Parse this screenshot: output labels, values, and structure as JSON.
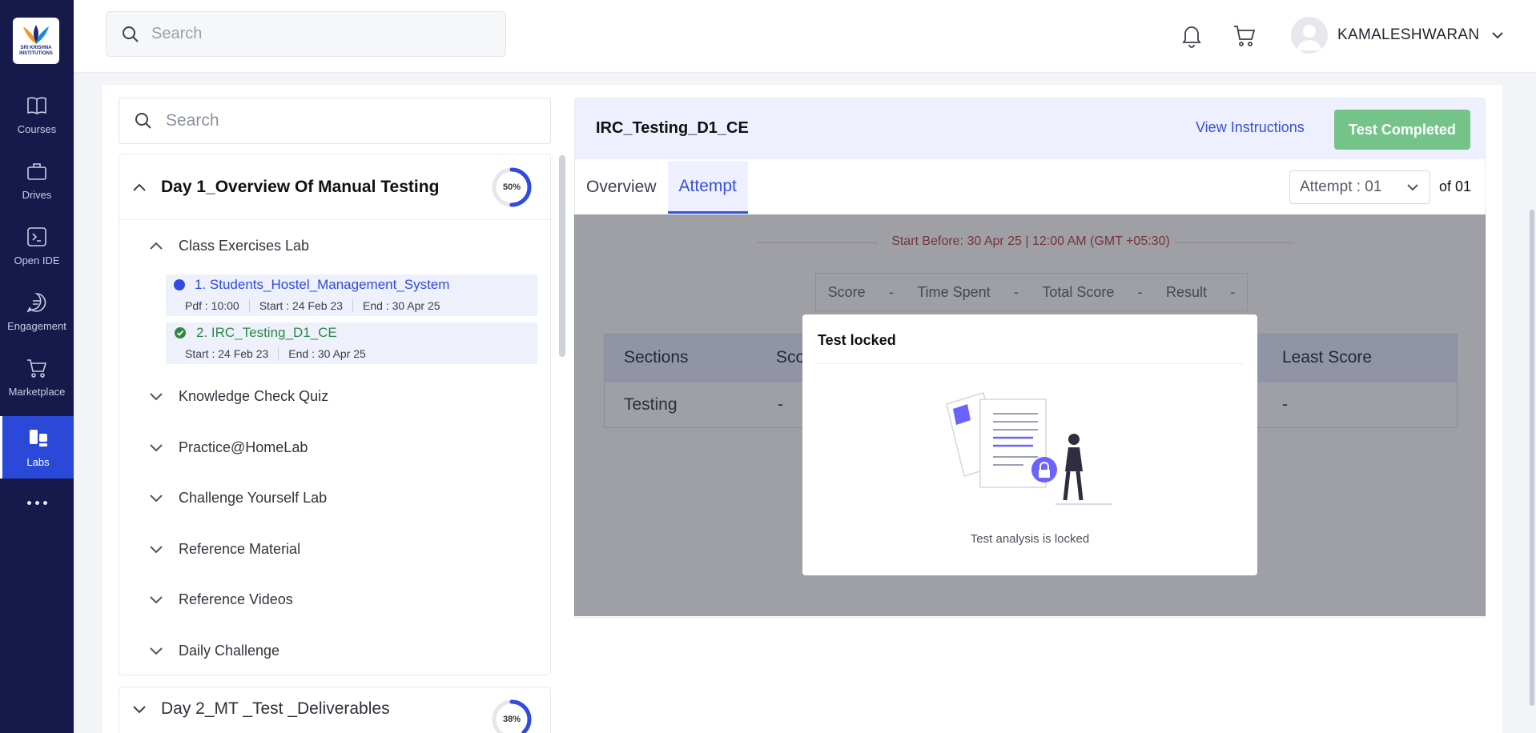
{
  "sidebar": {
    "logo_text": "SRI KRISHNA INSTITUTIONS",
    "items": [
      {
        "label": "Courses",
        "icon": "book-icon"
      },
      {
        "label": "Drives",
        "icon": "briefcase-icon"
      },
      {
        "label": "Open IDE",
        "icon": "terminal-icon"
      },
      {
        "label": "Engagement",
        "icon": "chat-icon"
      },
      {
        "label": "Marketplace",
        "icon": "cart-icon"
      },
      {
        "label": "Labs",
        "icon": "labs-icon",
        "active": true
      }
    ]
  },
  "topbar": {
    "search_placeholder": "Search",
    "user_name": "KAMALESHWARAN"
  },
  "left": {
    "search_placeholder": "Search",
    "day1": {
      "title": "Day 1_Overview Of Manual Testing",
      "progress": "50%",
      "progress_value": 0.5,
      "sections": {
        "class_exercises": "Class Exercises Lab",
        "knowledge_check": "Knowledge Check Quiz",
        "practice": "Practice@HomeLab",
        "challenge": "Challenge Yourself Lab",
        "reference_material": "Reference Material",
        "reference_videos": "Reference Videos",
        "daily_challenge": "Daily Challenge"
      },
      "items": [
        {
          "title": "1. Students_Hostel_Management_System",
          "pdf": "Pdf : 10:00",
          "start": "Start : 24 Feb 23",
          "end": "End : 30 Apr 25"
        },
        {
          "title": "2. IRC_Testing_D1_CE",
          "start": "Start : 24 Feb 23",
          "end": "End : 30 Apr 25"
        }
      ]
    },
    "day2": {
      "title": "Day 2_MT _Test _Deliverables",
      "progress": "38%",
      "progress_value": 0.38
    }
  },
  "right": {
    "title": "IRC_Testing_D1_CE",
    "view_instructions": "View Instructions",
    "status_button": "Test Completed",
    "tabs": [
      "Overview",
      "Attempt"
    ],
    "attempt_select": "Attempt : 01",
    "attempt_of": "of 01",
    "start_before": "Start Before: 30 Apr 25 | 12:00 AM (GMT +05:30)",
    "score_strip": [
      "Score",
      "-",
      "Time Spent",
      "-",
      "Total Score",
      "-",
      "Result",
      "-"
    ],
    "table": {
      "headers": [
        "Sections",
        "Sco",
        "Least Score"
      ],
      "row": [
        "Testing",
        "-",
        "-"
      ]
    }
  },
  "modal": {
    "title": "Test locked",
    "message": "Test analysis is locked"
  },
  "colors": {
    "sidebar_bg": "#161a4a",
    "accent": "#3650d8",
    "success": "#74c489",
    "danger": "#b9393b"
  }
}
